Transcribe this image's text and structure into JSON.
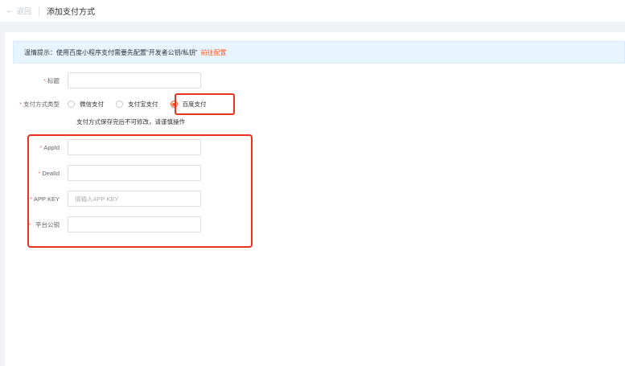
{
  "header": {
    "back_label": "返回",
    "title": "添加支付方式"
  },
  "notice": {
    "text": "温情提示：使用百度小程序支付需要先配置“开发者公钥/私钥”",
    "link": "前往配置"
  },
  "form": {
    "title_field": {
      "label": "标题",
      "value": "",
      "placeholder": ""
    },
    "pay_type": {
      "label": "支付方式类型",
      "options": [
        {
          "label": "微信支付",
          "checked": false
        },
        {
          "label": "支付宝支付",
          "checked": false
        },
        {
          "label": "百度支付",
          "checked": true
        }
      ],
      "hint": "支付方式保存完后不可修改，请谨慎操作"
    },
    "appid": {
      "label": "AppId",
      "value": "",
      "placeholder": ""
    },
    "dealid": {
      "label": "DealId",
      "value": "",
      "placeholder": ""
    },
    "app_key": {
      "label": "APP KEY",
      "value": "",
      "placeholder": "请输入APP KEY"
    },
    "public_key": {
      "label": "平台公钥",
      "value": "",
      "placeholder": ""
    }
  },
  "colors": {
    "accent": "#ff5722",
    "required": "#f56c6c",
    "highlight_box": "#e8341c",
    "notice_bg": "#e8f4ff"
  }
}
